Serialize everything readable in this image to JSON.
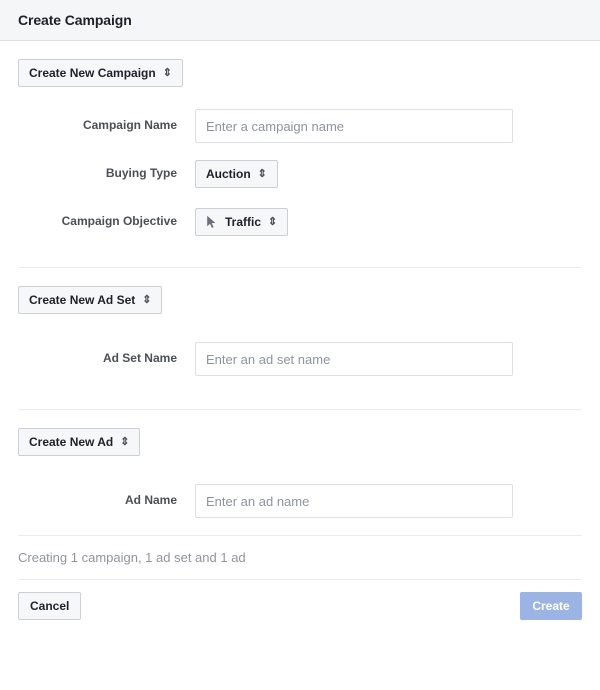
{
  "header": {
    "title": "Create Campaign"
  },
  "colors": {
    "header_bg": "#f5f6f7",
    "border": "#dddfe2",
    "divider": "#e9ebee",
    "label_text": "#4b4f56",
    "title_text": "#1d2129",
    "placeholder": "#8d949e",
    "status_text": "#90949c",
    "create_button_bg": "#9cb4e3",
    "create_button_text": "#ffffff",
    "secondary_button_bg": "#f6f7f9",
    "secondary_button_border": "#ccd0d5"
  },
  "campaign_section": {
    "selector_label": "Create New Campaign",
    "selector_caret": "⇕",
    "fields": [
      {
        "label": "Campaign Name",
        "type": "text",
        "value": "",
        "placeholder": "Enter a campaign name"
      },
      {
        "label": "Buying Type",
        "type": "select",
        "value": "Auction",
        "caret": "⇕"
      },
      {
        "label": "Campaign Objective",
        "type": "select",
        "value": "Traffic",
        "caret": "⇕",
        "icon": "cursor-pointer-icon"
      }
    ]
  },
  "adset_section": {
    "selector_label": "Create New Ad Set",
    "selector_caret": "⇕",
    "fields": [
      {
        "label": "Ad Set Name",
        "type": "text",
        "value": "",
        "placeholder": "Enter an ad set name"
      }
    ]
  },
  "ad_section": {
    "selector_label": "Create New Ad",
    "selector_caret": "⇕",
    "fields": [
      {
        "label": "Ad Name",
        "type": "text",
        "value": "",
        "placeholder": "Enter an ad name"
      }
    ]
  },
  "status": {
    "text": "Creating 1 campaign, 1 ad set and 1 ad"
  },
  "footer": {
    "cancel_label": "Cancel",
    "create_label": "Create",
    "create_disabled": true
  }
}
